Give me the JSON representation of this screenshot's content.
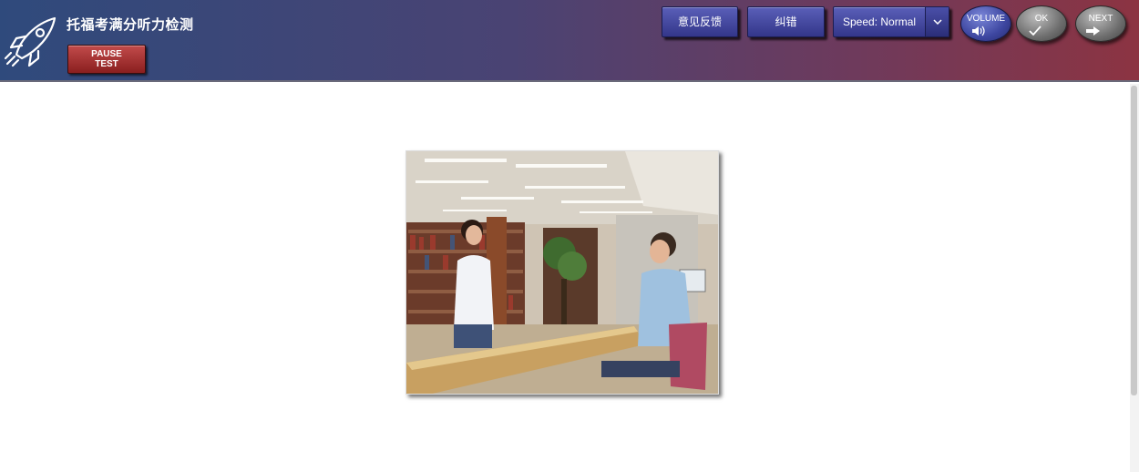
{
  "header": {
    "app_title": "托福考满分听力检测",
    "pause_label": "PAUSE\nTEST",
    "feedback_label": "意见反馈",
    "correct_label": "纠错",
    "speed_label": "Speed: Normal",
    "volume_label": "VOLUME",
    "ok_label": "OK",
    "next_label": "NEXT"
  },
  "colors": {
    "toolbar_left": "#2f4a7c",
    "toolbar_right": "#8c3442",
    "pause_button": "#8a1f1f",
    "blue_button": "#33368a"
  },
  "icons": {
    "logo": "rocket-logo-icon",
    "speed_dropdown": "chevron-down-icon",
    "volume": "speaker-icon",
    "ok": "checkmark-icon",
    "next": "arrow-right-icon"
  },
  "main": {
    "image_subject": "library-conversation-photo"
  }
}
